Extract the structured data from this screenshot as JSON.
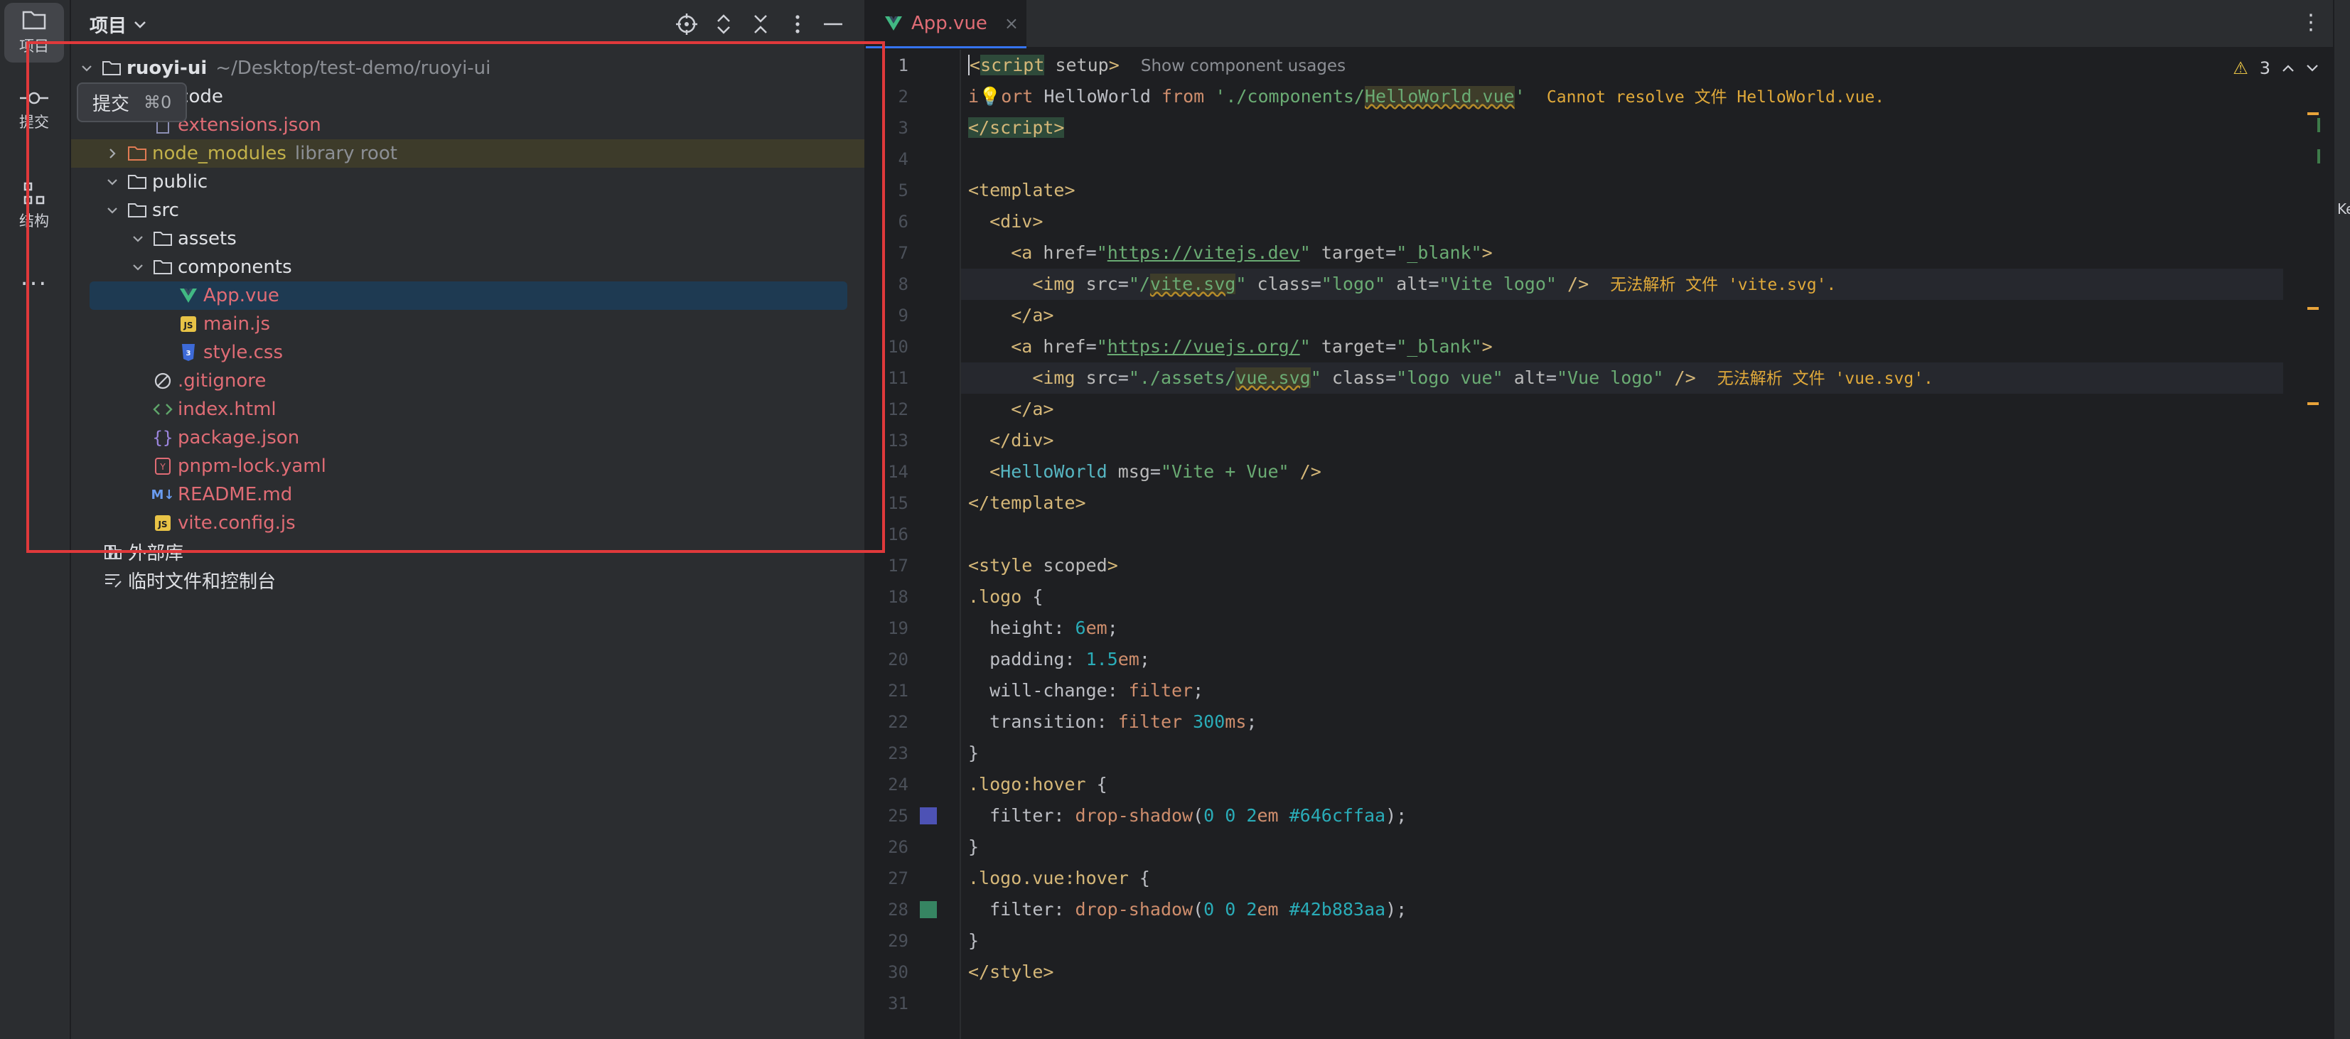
{
  "stripe": {
    "project_label": "项目",
    "commit_label": "提交",
    "structure_label": "结构",
    "more_label": "..."
  },
  "tooltip": {
    "text": "提交",
    "shortcut": "⌘0"
  },
  "panel": {
    "title": "项目"
  },
  "tree": [
    {
      "name": "ruoyi-ui",
      "hint": "~/Desktop/test-demo/ruoyi-ui",
      "icon": "folder-icon",
      "bold": true
    },
    {
      "name": ".vscode",
      "icon": "folder-icon"
    },
    {
      "name": "extensions.json",
      "icon": "json-file-icon",
      "color": "red"
    },
    {
      "name": "node_modules",
      "hint": "library root",
      "icon": "folder-icon",
      "color": "yellow"
    },
    {
      "name": "public",
      "icon": "folder-icon"
    },
    {
      "name": "src",
      "icon": "folder-icon"
    },
    {
      "name": "assets",
      "icon": "folder-icon"
    },
    {
      "name": "components",
      "icon": "folder-icon"
    },
    {
      "name": "App.vue",
      "icon": "vue-file-icon",
      "color": "red"
    },
    {
      "name": "main.js",
      "icon": "js-file-icon",
      "color": "red"
    },
    {
      "name": "style.css",
      "icon": "css-file-icon",
      "color": "red"
    },
    {
      "name": ".gitignore",
      "icon": "gitignore-file-icon",
      "color": "red"
    },
    {
      "name": "index.html",
      "icon": "html-file-icon",
      "color": "red"
    },
    {
      "name": "package.json",
      "icon": "json-file-icon",
      "color": "red"
    },
    {
      "name": "pnpm-lock.yaml",
      "icon": "yaml-file-icon",
      "color": "red"
    },
    {
      "name": "README.md",
      "icon": "markdown-file-icon",
      "color": "red"
    },
    {
      "name": "vite.config.js",
      "icon": "js-file-icon",
      "color": "red"
    },
    {
      "name": "外部库",
      "icon": "library-icon"
    },
    {
      "name": "临时文件和控制台",
      "icon": "scratches-icon"
    }
  ],
  "editor": {
    "tab": "App.vue",
    "tab_close": "×",
    "more": "⋮",
    "warnings_count": "3",
    "line_numbers": [
      "1",
      "2",
      "3",
      "4",
      "5",
      "6",
      "7",
      "8",
      "9",
      "10",
      "11",
      "12",
      "13",
      "14",
      "15",
      "16",
      "17",
      "18",
      "19",
      "20",
      "21",
      "22",
      "23",
      "24",
      "25",
      "26",
      "27",
      "28",
      "29",
      "30",
      "31"
    ],
    "swatch_colors": {
      "line25": "#646cffaa",
      "line28": "#42b883aa"
    }
  },
  "code": {
    "l1_hint": "Show component usages",
    "l2_err": "Cannot resolve 文件 HelloWorld.vue.",
    "l8_err": "无法解析 文件 'vite.svg'.",
    "l11_err": "无法解析 文件 'vue.svg'."
  },
  "right_edge_text": "Ke"
}
